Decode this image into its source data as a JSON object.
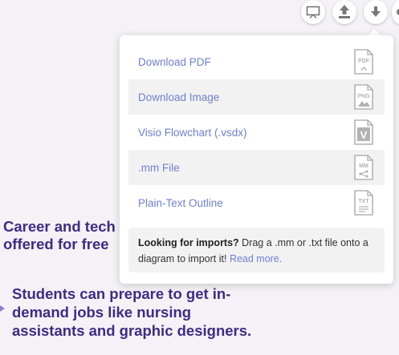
{
  "background": {
    "text1": "Career and tech\noffered for free",
    "text2": "Students can prepare to get in-\ndemand jobs like nursing\nassistants and graphic designers."
  },
  "toolbar": {
    "buttons": [
      {
        "icon": "presentation-icon"
      },
      {
        "icon": "share-icon"
      },
      {
        "icon": "download-icon"
      }
    ]
  },
  "download_menu": {
    "items": [
      {
        "label": "Download PDF",
        "icon": "pdf-file-icon",
        "icon_text": "PDF"
      },
      {
        "label": "Download Image",
        "icon": "png-file-icon",
        "icon_text": "PNG"
      },
      {
        "label": "Visio Flowchart (.vsdx)",
        "icon": "visio-file-icon",
        "icon_text": "V"
      },
      {
        "label": ".mm File",
        "icon": "mm-file-icon",
        "icon_text": "MM"
      },
      {
        "label": "Plain-Text Outline",
        "icon": "txt-file-icon",
        "icon_text": "TXT"
      }
    ],
    "imports": {
      "heading": "Looking for imports?",
      "body": " Drag a .mm or .txt file onto a diagram to import it! ",
      "link": "Read more."
    }
  },
  "colors": {
    "accent": "#6f7fd0",
    "diagram_text": "#3d2c85",
    "icon_gray": "#b3b3b3"
  }
}
